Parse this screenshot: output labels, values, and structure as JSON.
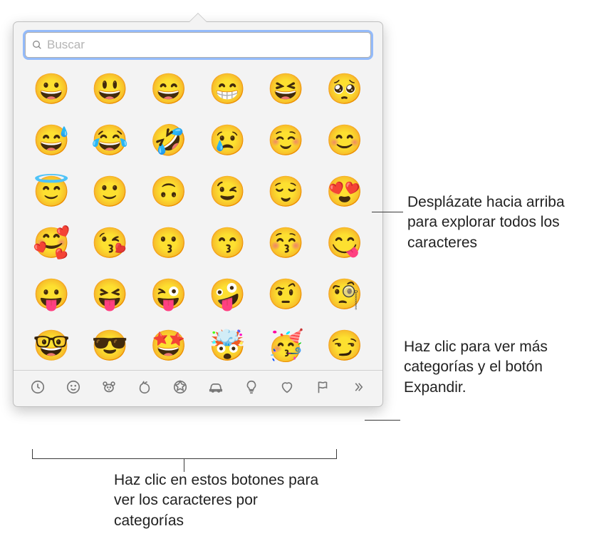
{
  "search": {
    "placeholder": "Buscar",
    "value": ""
  },
  "emojis": [
    [
      "😀",
      "😃",
      "😄",
      "😁",
      "😆",
      "🥺"
    ],
    [
      "😅",
      "😂",
      "🤣",
      "😢",
      "☺️",
      "😊"
    ],
    [
      "😇",
      "🙂",
      "🙃",
      "😉",
      "😌",
      "😍"
    ],
    [
      "🥰",
      "😘",
      "😗",
      "😙",
      "😚",
      "😋"
    ],
    [
      "😛",
      "😝",
      "😜",
      "🤪",
      "🤨",
      "🧐"
    ],
    [
      "🤓",
      "😎",
      "🤩",
      "🤯",
      "🥳",
      "😏"
    ]
  ],
  "categories": [
    {
      "id": "recent",
      "label": "Usados frecuentemente"
    },
    {
      "id": "smileys",
      "label": "Caritas y personas"
    },
    {
      "id": "animals",
      "label": "Animales y naturaleza"
    },
    {
      "id": "food",
      "label": "Comida y bebida"
    },
    {
      "id": "activity",
      "label": "Actividad"
    },
    {
      "id": "travel",
      "label": "Viajes y lugares"
    },
    {
      "id": "objects",
      "label": "Objetos"
    },
    {
      "id": "symbols",
      "label": "Símbolos"
    },
    {
      "id": "flags",
      "label": "Banderas"
    }
  ],
  "more_label": "Más categorías",
  "callouts": {
    "scroll": "Desplázate hacia arriba para explorar todos los caracteres",
    "more": "Haz clic para ver más categorías y el botón Expandir.",
    "cats": "Haz clic en estos botones para ver los caracteres por categorías"
  }
}
